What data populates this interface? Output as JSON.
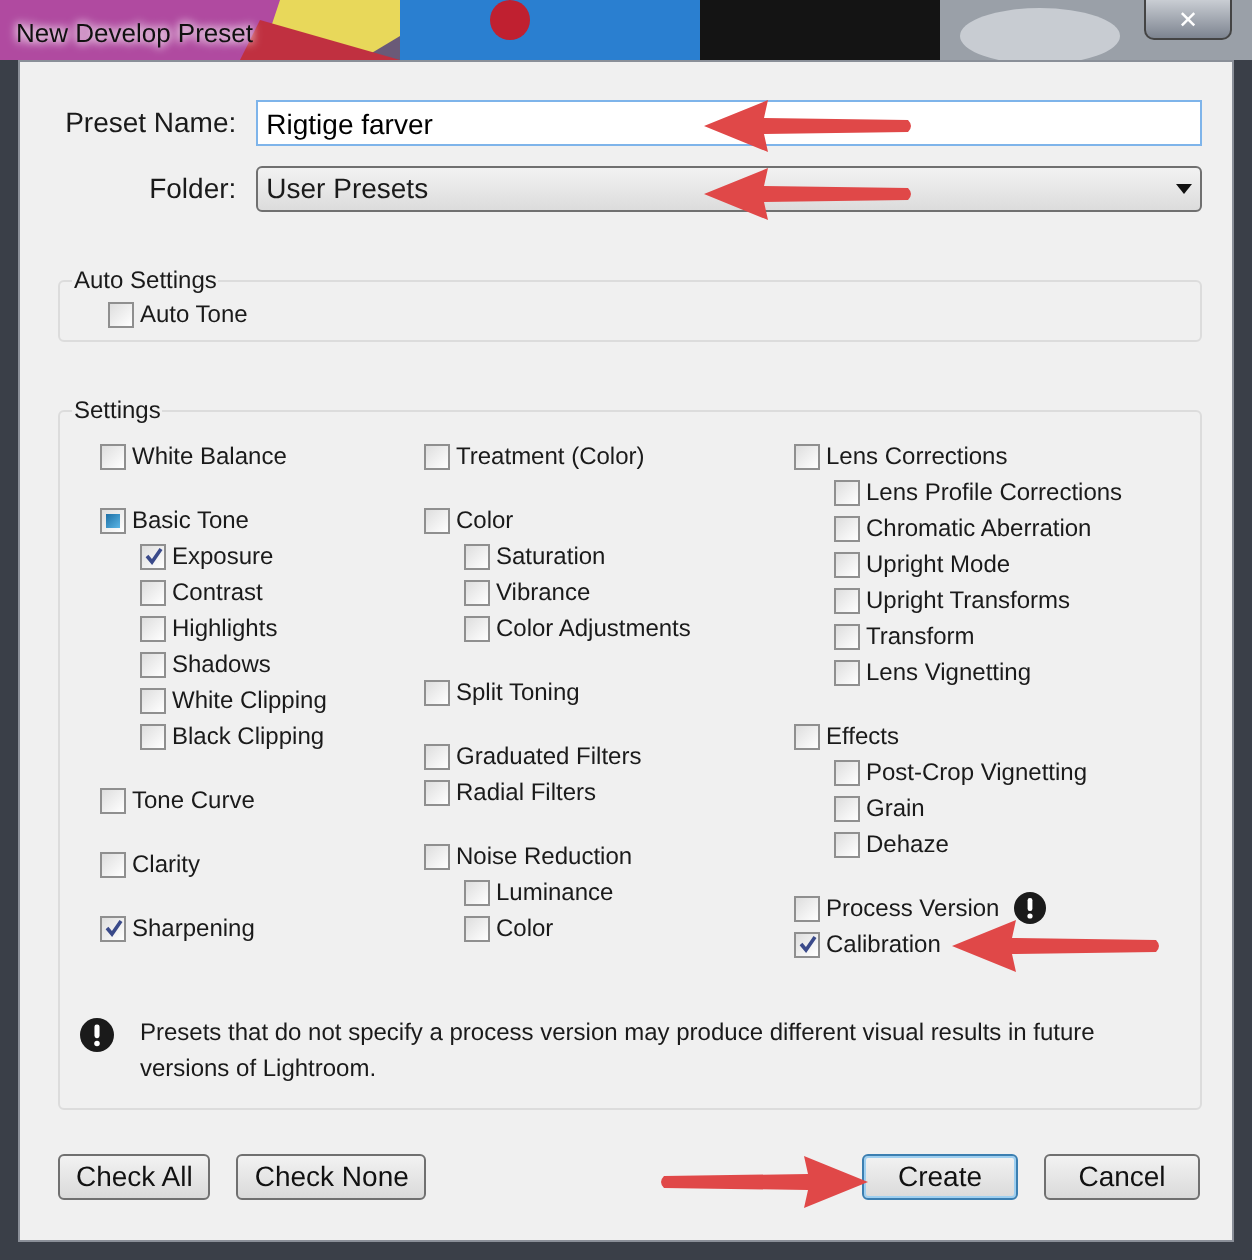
{
  "window": {
    "title": "New Develop Preset",
    "close_button": "✕"
  },
  "preset_name": {
    "label": "Preset Name:",
    "value": "Rigtige farver"
  },
  "folder": {
    "label": "Folder:",
    "value": "User Presets"
  },
  "auto_settings": {
    "title": "Auto Settings",
    "items": [
      {
        "label": "Auto Tone",
        "checked": false
      }
    ]
  },
  "settings": {
    "title": "Settings",
    "columns": [
      [
        [
          {
            "label": "White Balance",
            "checked": false
          }
        ],
        [
          {
            "label": "Basic Tone",
            "checked": false,
            "indeterminate": true,
            "children": [
              {
                "label": "Exposure",
                "checked": true
              },
              {
                "label": "Contrast",
                "checked": false
              },
              {
                "label": "Highlights",
                "checked": false
              },
              {
                "label": "Shadows",
                "checked": false
              },
              {
                "label": "White Clipping",
                "checked": false
              },
              {
                "label": "Black Clipping",
                "checked": false
              }
            ]
          }
        ],
        [
          {
            "label": "Tone Curve",
            "checked": false
          }
        ],
        [
          {
            "label": "Clarity",
            "checked": false
          }
        ],
        [
          {
            "label": "Sharpening",
            "checked": true
          }
        ]
      ],
      [
        [
          {
            "label": "Treatment (Color)",
            "checked": false
          }
        ],
        [
          {
            "label": "Color",
            "checked": false,
            "children": [
              {
                "label": "Saturation",
                "checked": false
              },
              {
                "label": "Vibrance",
                "checked": false
              },
              {
                "label": "Color Adjustments",
                "checked": false
              }
            ]
          }
        ],
        [
          {
            "label": "Split Toning",
            "checked": false
          }
        ],
        [
          {
            "label": "Graduated Filters",
            "checked": false
          },
          {
            "label": "Radial Filters",
            "checked": false
          }
        ],
        [
          {
            "label": "Noise Reduction",
            "checked": false,
            "children": [
              {
                "label": "Luminance",
                "checked": false
              },
              {
                "label": "Color",
                "checked": false
              }
            ]
          }
        ]
      ],
      [
        [
          {
            "label": "Lens Corrections",
            "checked": false,
            "children": [
              {
                "label": "Lens Profile Corrections",
                "checked": false
              },
              {
                "label": "Chromatic Aberration",
                "checked": false
              },
              {
                "label": "Upright Mode",
                "checked": false
              },
              {
                "label": "Upright Transforms",
                "checked": false
              },
              {
                "label": "Transform",
                "checked": false
              },
              {
                "label": "Lens Vignetting",
                "checked": false
              }
            ]
          }
        ],
        [
          {
            "label": "Effects",
            "checked": false,
            "children": [
              {
                "label": "Post-Crop Vignetting",
                "checked": false
              },
              {
                "label": "Grain",
                "checked": false
              },
              {
                "label": "Dehaze",
                "checked": false
              }
            ]
          }
        ],
        [
          {
            "label": "Process Version",
            "checked": false,
            "warning": true
          },
          {
            "label": "Calibration",
            "checked": true,
            "warning": false
          }
        ]
      ]
    ],
    "note": "Presets that do not specify a process version may produce different visual results in future versions of Lightroom."
  },
  "buttons_left": [
    "Check All",
    "Check None"
  ],
  "buttons_right": [
    {
      "label": "Create",
      "default": true
    },
    {
      "label": "Cancel",
      "default": false
    }
  ]
}
